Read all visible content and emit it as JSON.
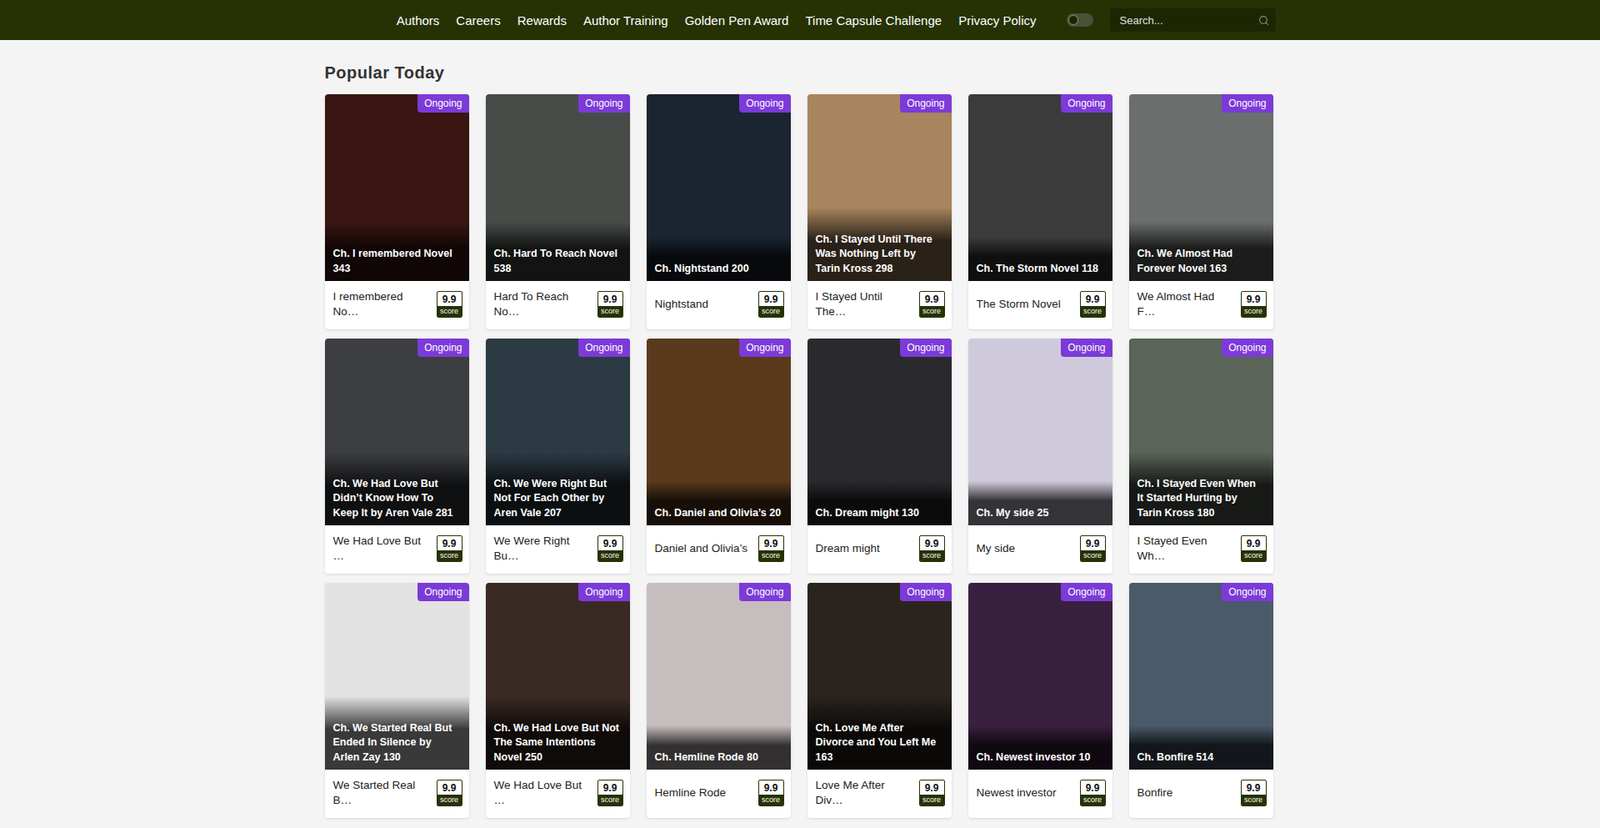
{
  "nav": {
    "links": [
      "Authors",
      "Careers",
      "Rewards",
      "Author Training",
      "Golden Pen Award",
      "Time Capsule Challenge",
      "Privacy Policy"
    ],
    "dark_mode": {
      "on": false
    },
    "search": {
      "placeholder": "Search..."
    }
  },
  "section": {
    "title": "Popular Today"
  },
  "books": [
    {
      "chapter": "Ch. I remembered Novel 343",
      "title": "I remembered No…",
      "status": "Ongoing",
      "score": "9.9",
      "score_label": "score",
      "color": "#3a1612"
    },
    {
      "chapter": "Ch. Hard To Reach Novel 538",
      "title": "Hard To Reach No…",
      "status": "Ongoing",
      "score": "9.9",
      "score_label": "score",
      "color": "#474c48"
    },
    {
      "chapter": "Ch. Nightstand 200",
      "title": "Nightstand",
      "status": "Ongoing",
      "score": "9.9",
      "score_label": "score",
      "color": "#1b2431"
    },
    {
      "chapter": "Ch. I Stayed Until There Was Nothing Left by Tarin Kross 298",
      "title": "I Stayed Until The…",
      "status": "Ongoing",
      "score": "9.9",
      "score_label": "score",
      "color": "#a7855e"
    },
    {
      "chapter": "Ch. The Storm Novel 118",
      "title": "The Storm Novel",
      "status": "Ongoing",
      "score": "9.9",
      "score_label": "score",
      "color": "#3b3b3b"
    },
    {
      "chapter": "Ch. We Almost Had Forever Novel 163",
      "title": "We Almost Had F…",
      "status": "Ongoing",
      "score": "9.9",
      "score_label": "score",
      "color": "#6a6e6c"
    },
    {
      "chapter": "Ch. We Had Love But Didn’t Know How To Keep It by Aren Vale 281",
      "title": "We Had Love But …",
      "status": "Ongoing",
      "score": "9.9",
      "score_label": "score",
      "color": "#3c3e42"
    },
    {
      "chapter": "Ch. We Were Right But Not For Each Other by Aren Vale 207",
      "title": "We Were Right Bu…",
      "status": "Ongoing",
      "score": "9.9",
      "score_label": "score",
      "color": "#2c3a44"
    },
    {
      "chapter": "Ch. Daniel and Olivia’s 20",
      "title": "Daniel and Olivia’s",
      "status": "Ongoing",
      "score": "9.9",
      "score_label": "score",
      "color": "#5a3a1c"
    },
    {
      "chapter": "Ch. Dream might 130",
      "title": "Dream might",
      "status": "Ongoing",
      "score": "9.9",
      "score_label": "score",
      "color": "#2a2a2e"
    },
    {
      "chapter": "Ch. My side 25",
      "title": "My side",
      "status": "Ongoing",
      "score": "9.9",
      "score_label": "score",
      "color": "#cfcadb"
    },
    {
      "chapter": "Ch. I Stayed Even When It Started Hurting by Tarin Kross 180",
      "title": "I Stayed Even Wh…",
      "status": "Ongoing",
      "score": "9.9",
      "score_label": "score",
      "color": "#5a6458"
    },
    {
      "chapter": "Ch. We Started Real But Ended In Silence by Arlen Zay 130",
      "title": "We Started Real B…",
      "status": "Ongoing",
      "score": "9.9",
      "score_label": "score",
      "color": "#e2e2e2"
    },
    {
      "chapter": "Ch. We Had Love But Not The Same Intentions Novel 250",
      "title": "We Had Love But …",
      "status": "Ongoing",
      "score": "9.9",
      "score_label": "score",
      "color": "#3a2a24"
    },
    {
      "chapter": "Ch. Hemline Rode 80",
      "title": "Hemline Rode",
      "status": "Ongoing",
      "score": "9.9",
      "score_label": "score",
      "color": "#c6bebe"
    },
    {
      "chapter": "Ch. Love Me After Divorce and You Left Me 163",
      "title": "Love Me After Div…",
      "status": "Ongoing",
      "score": "9.9",
      "score_label": "score",
      "color": "#2a241e"
    },
    {
      "chapter": "Ch. Newest investor 10",
      "title": "Newest investor",
      "status": "Ongoing",
      "score": "9.9",
      "score_label": "score",
      "color": "#3a2040"
    },
    {
      "chapter": "Ch. Bonfire 514",
      "title": "Bonfire",
      "status": "Ongoing",
      "score": "9.9",
      "score_label": "score",
      "color": "#4a5a6a"
    }
  ]
}
